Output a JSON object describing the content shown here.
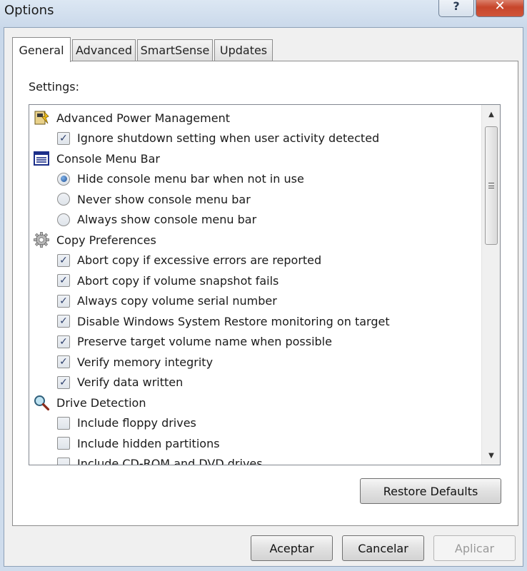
{
  "window": {
    "title": "Options",
    "help_glyph": "?",
    "close_glyph": "✕"
  },
  "tabs": [
    {
      "label": "General",
      "active": true
    },
    {
      "label": "Advanced",
      "active": false
    },
    {
      "label": "SmartSense",
      "active": false
    },
    {
      "label": "Updates",
      "active": false
    }
  ],
  "panel": {
    "settings_label": "Settings:",
    "restore_defaults_label": "Restore Defaults"
  },
  "settings": [
    {
      "kind": "group",
      "icon": "power-management-icon",
      "label": "Advanced Power Management"
    },
    {
      "kind": "check",
      "checked": true,
      "label": "Ignore shutdown setting when user activity detected"
    },
    {
      "kind": "group",
      "icon": "console-menu-icon",
      "label": "Console Menu Bar"
    },
    {
      "kind": "radio",
      "checked": true,
      "label": "Hide console menu bar when not in use"
    },
    {
      "kind": "radio",
      "checked": false,
      "label": "Never show console menu bar"
    },
    {
      "kind": "radio",
      "checked": false,
      "label": "Always show console menu bar"
    },
    {
      "kind": "group",
      "icon": "gear-icon",
      "label": "Copy Preferences"
    },
    {
      "kind": "check",
      "checked": true,
      "label": "Abort copy if excessive errors are reported"
    },
    {
      "kind": "check",
      "checked": true,
      "label": "Abort copy if volume snapshot fails"
    },
    {
      "kind": "check",
      "checked": true,
      "label": "Always copy volume serial number"
    },
    {
      "kind": "check",
      "checked": true,
      "label": "Disable Windows System Restore monitoring on target"
    },
    {
      "kind": "check",
      "checked": true,
      "label": "Preserve target volume name when possible"
    },
    {
      "kind": "check",
      "checked": true,
      "label": "Verify memory integrity"
    },
    {
      "kind": "check",
      "checked": true,
      "label": "Verify data written"
    },
    {
      "kind": "group",
      "icon": "magnifier-icon",
      "label": "Drive Detection"
    },
    {
      "kind": "check",
      "checked": false,
      "label": "Include floppy drives"
    },
    {
      "kind": "check",
      "checked": false,
      "label": "Include hidden partitions"
    },
    {
      "kind": "check",
      "checked": false,
      "label": "Include CD-ROM and DVD drives"
    }
  ],
  "buttons": {
    "ok_label": "Aceptar",
    "cancel_label": "Cancelar",
    "apply_label": "Aplicar"
  },
  "colors": {
    "title_bar": "#dce7f3",
    "close_button": "#c7462b",
    "check_mark": "#2a3d6b"
  }
}
